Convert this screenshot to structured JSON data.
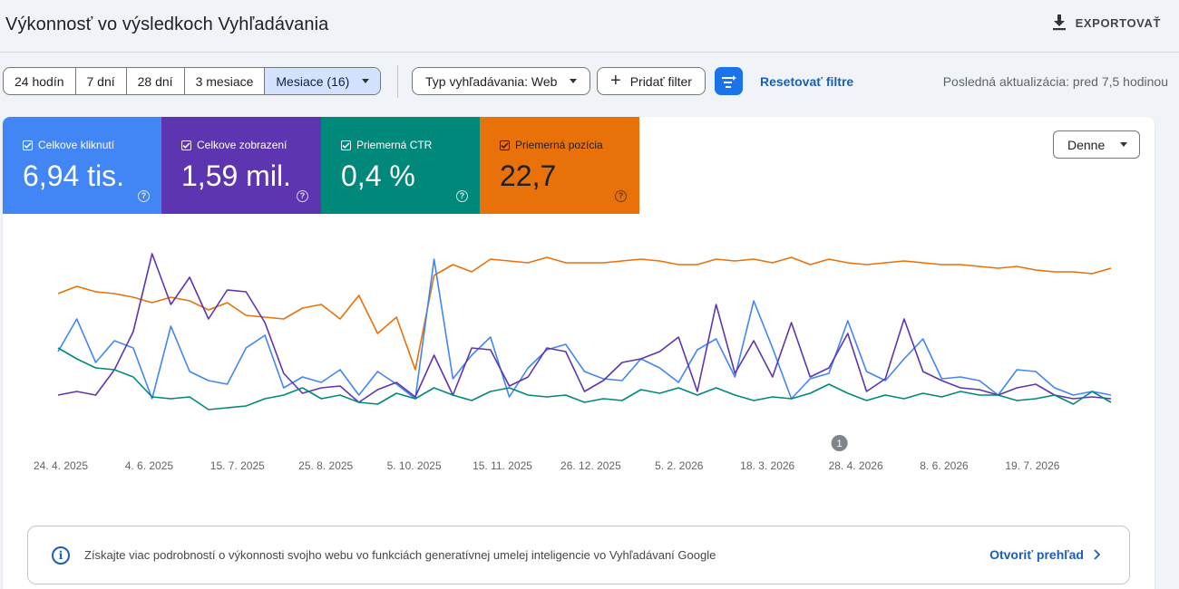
{
  "page": {
    "title": "Výkonnosť vo výsledkoch Vyhľadávania",
    "export_label": "EXPORTOVAŤ"
  },
  "date_ranges": [
    {
      "label": "24 hodín",
      "active": false
    },
    {
      "label": "7 dní",
      "active": false
    },
    {
      "label": "28 dní",
      "active": false
    },
    {
      "label": "3 mesiace",
      "active": false
    },
    {
      "label": "Mesiace (16)",
      "active": true
    }
  ],
  "filters": {
    "search_type": "Typ vyhľadávania: Web",
    "add_filter": "Pridať filter",
    "reset": "Resetovať filtre",
    "last_updated": "Posledná aktualizácia: pred 7,5 hodinou"
  },
  "metrics": [
    {
      "label": "Celkove kliknutí",
      "value": "6,94 tis.",
      "color": "#4285f4",
      "checked": true
    },
    {
      "label": "Celkove zobrazení",
      "value": "1,59 mil.",
      "color": "#5e35b1",
      "checked": true
    },
    {
      "label": "Priemerná CTR",
      "value": "0,4 %",
      "color": "#00897b",
      "checked": true
    },
    {
      "label": "Priemerná pozícia",
      "value": "22,7",
      "color": "#e8710a",
      "checked": true
    }
  ],
  "granularity": "Denne",
  "chart_data": {
    "type": "line",
    "x_tick_labels": [
      "24. 4. 2025",
      "4. 6. 2025",
      "15. 7. 2025",
      "25. 8. 2025",
      "5. 10. 2025",
      "15. 11. 2025",
      "26. 12. 2025",
      "5. 2. 2026",
      "18. 3. 2026",
      "28. 4. 2026",
      "8. 6. 2026",
      "19. 7. 2026"
    ],
    "annotation": {
      "label": "1",
      "date": "28. 4. 2026"
    },
    "series": [
      {
        "color": "#e8710a",
        "values": [
          0.76,
          0.8,
          0.77,
          0.76,
          0.74,
          0.71,
          0.74,
          0.72,
          0.67,
          0.71,
          0.64,
          0.63,
          0.62,
          0.68,
          0.7,
          0.62,
          0.75,
          0.54,
          0.63,
          0.34,
          0.86,
          0.92,
          0.88,
          0.95,
          0.94,
          0.93,
          0.96,
          0.93,
          0.93,
          0.93,
          0.94,
          0.95,
          0.94,
          0.92,
          0.92,
          0.95,
          0.94,
          0.95,
          0.93,
          0.96,
          0.92,
          0.95,
          0.93,
          0.92,
          0.93,
          0.94,
          0.93,
          0.92,
          0.92,
          0.91,
          0.9,
          0.91,
          0.89,
          0.88,
          0.88,
          0.87,
          0.9
        ]
      },
      {
        "color": "#4285f4",
        "values": [
          0.44,
          0.62,
          0.38,
          0.5,
          0.46,
          0.18,
          0.58,
          0.33,
          0.28,
          0.26,
          0.46,
          0.53,
          0.24,
          0.3,
          0.27,
          0.34,
          0.2,
          0.33,
          0.26,
          0.18,
          0.95,
          0.29,
          0.42,
          0.52,
          0.19,
          0.35,
          0.45,
          0.48,
          0.33,
          0.29,
          0.28,
          0.4,
          0.35,
          0.27,
          0.45,
          0.51,
          0.3,
          0.72,
          0.46,
          0.18,
          0.29,
          0.32,
          0.61,
          0.33,
          0.28,
          0.4,
          0.51,
          0.29,
          0.3,
          0.28,
          0.2,
          0.34,
          0.33,
          0.24,
          0.2,
          0.22,
          0.2
        ]
      },
      {
        "color": "#5e35b1",
        "values": [
          0.2,
          0.22,
          0.2,
          0.34,
          0.55,
          0.98,
          0.7,
          0.85,
          0.62,
          0.78,
          0.77,
          0.6,
          0.32,
          0.21,
          0.24,
          0.25,
          0.16,
          0.23,
          0.27,
          0.19,
          0.42,
          0.2,
          0.46,
          0.45,
          0.25,
          0.3,
          0.46,
          0.44,
          0.22,
          0.28,
          0.38,
          0.4,
          0.44,
          0.52,
          0.22,
          0.7,
          0.32,
          0.5,
          0.3,
          0.6,
          0.3,
          0.35,
          0.54,
          0.22,
          0.29,
          0.62,
          0.33,
          0.28,
          0.24,
          0.23,
          0.2,
          0.24,
          0.26,
          0.2,
          0.18,
          0.19,
          0.18
        ]
      },
      {
        "color": "#00897b",
        "values": [
          0.46,
          0.4,
          0.35,
          0.34,
          0.3,
          0.19,
          0.18,
          0.19,
          0.12,
          0.13,
          0.14,
          0.18,
          0.2,
          0.24,
          0.18,
          0.2,
          0.16,
          0.15,
          0.21,
          0.18,
          0.24,
          0.2,
          0.17,
          0.22,
          0.24,
          0.2,
          0.19,
          0.2,
          0.16,
          0.18,
          0.17,
          0.23,
          0.21,
          0.24,
          0.2,
          0.24,
          0.2,
          0.17,
          0.19,
          0.18,
          0.21,
          0.26,
          0.21,
          0.17,
          0.2,
          0.18,
          0.21,
          0.19,
          0.22,
          0.2,
          0.2,
          0.17,
          0.18,
          0.2,
          0.15,
          0.22,
          0.16
        ]
      }
    ]
  },
  "banner": {
    "info_icon": "i",
    "text": "Získajte viac podrobností o výkonnosti svojho webu vo funkciách generatívnej umelej inteligencie vo Vyhľadávaní Google",
    "link": "Otvoriť prehľad"
  }
}
